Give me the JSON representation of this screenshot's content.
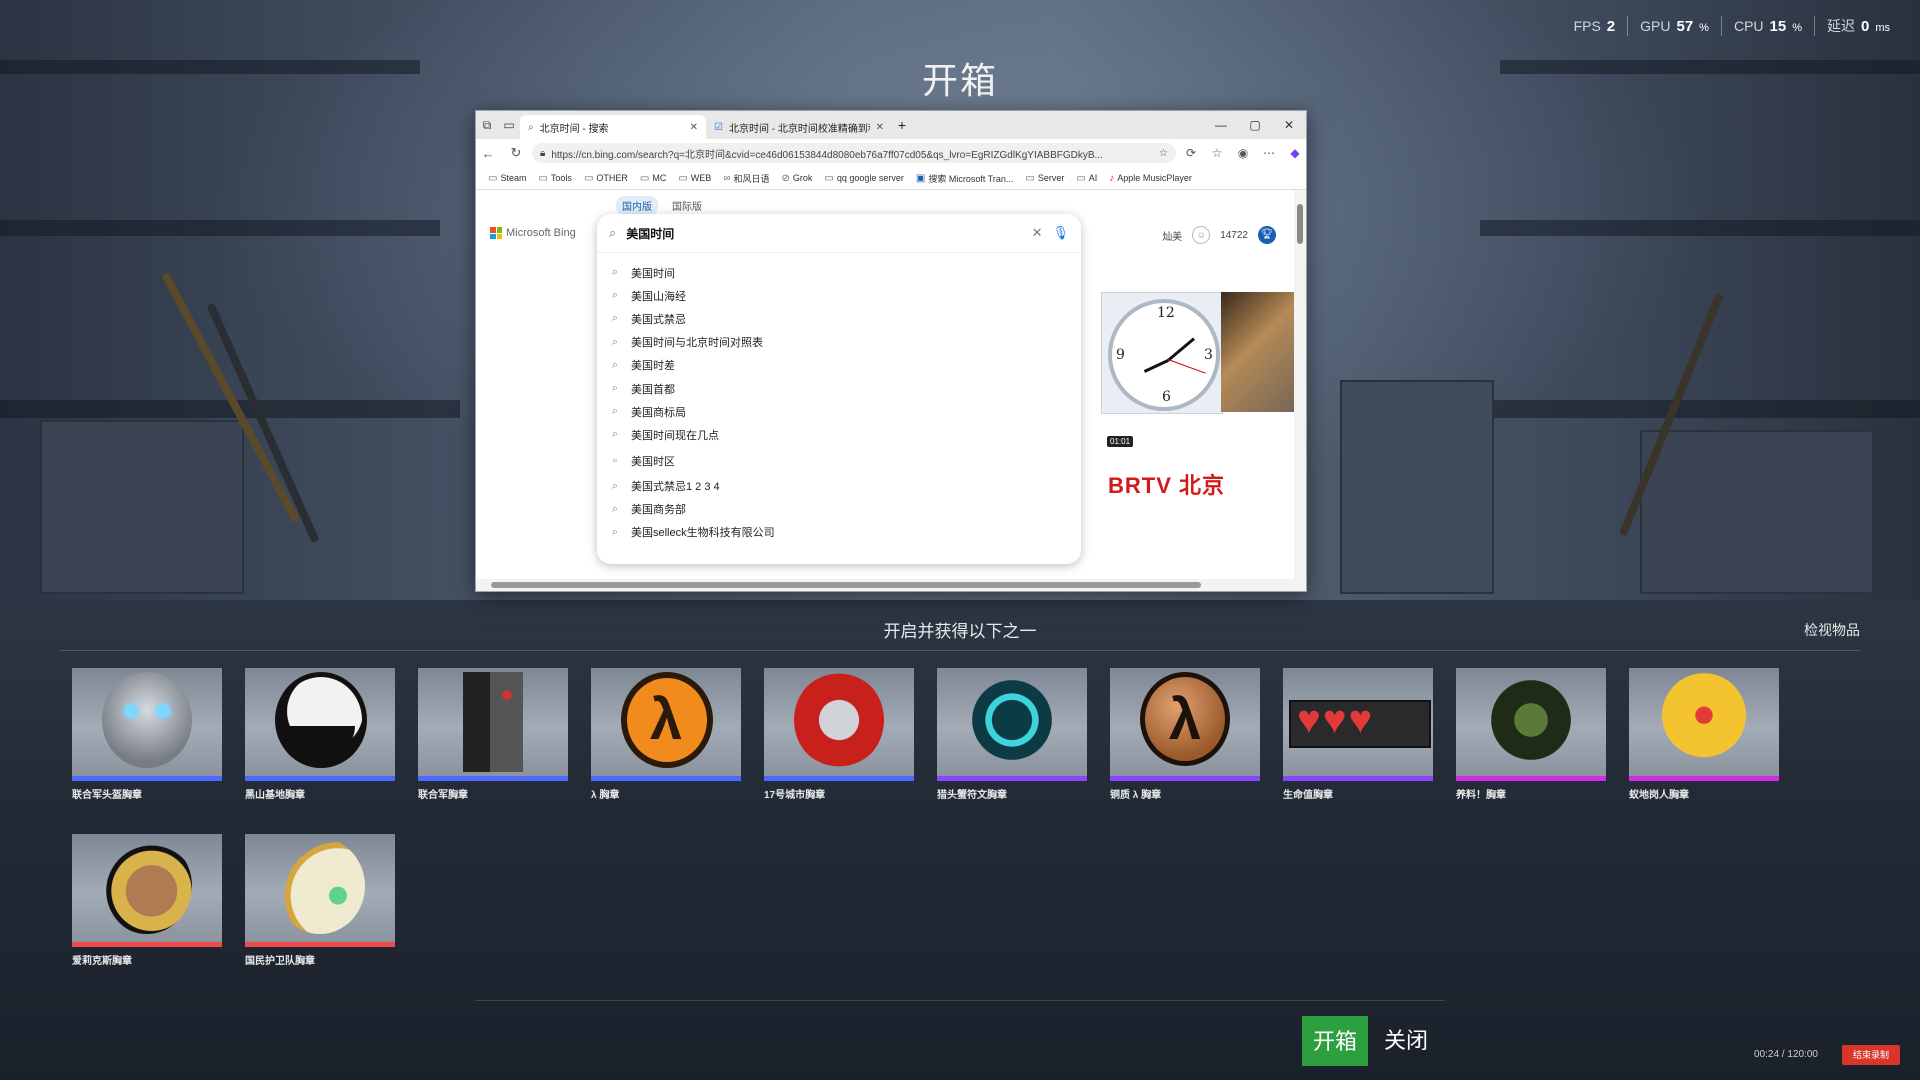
{
  "hud": {
    "fps_label": "FPS",
    "fps_value": "2",
    "gpu_label": "GPU",
    "gpu_value": "57",
    "gpu_unit": "%",
    "cpu_label": "CPU",
    "cpu_value": "15",
    "cpu_unit": "%",
    "latency_label": "延迟",
    "latency_value": "0",
    "latency_unit": "ms"
  },
  "title": "开箱",
  "browser": {
    "tabs": [
      {
        "label": "北京时间 - 搜索"
      },
      {
        "label": "北京时间 - 北京时间校准精确到秒"
      }
    ],
    "url": "https://cn.bing.com/search?q=北京时间&cvid=ce46d06153844d8080eb76a7ff07cd05&qs_lvro=EgRIZGdlKgYIABBFGDkyB...",
    "favorites": [
      "Steam",
      "Tools",
      "OTHER",
      "MC",
      "WEB",
      "和风日语",
      "Grok",
      "qq google server",
      "搜索 Microsoft Tran...",
      "Server",
      "AI",
      "Apple MusicPlayer"
    ],
    "scope_tabs": [
      "国内版",
      "国际版"
    ],
    "logo_text": "Microsoft Bing",
    "search_query": "美国时间",
    "suggestions": [
      "美国时间",
      "美国山海经",
      "美国式禁忌",
      "美国时间与北京时间对照表",
      "美国时差",
      "美国首都",
      "美国商标局",
      "美国时间现在几点",
      "美国时区",
      "美国式禁忌1 2 3 4",
      "美国商务部",
      "美国selleck生物科技有限公司"
    ],
    "user_name": "灿美",
    "points": "14722",
    "video_duration": "01:01",
    "video_brand": "BRTV 北京"
  },
  "panel": {
    "heading": "开启并获得以下之一",
    "inspect_label": "检视物品"
  },
  "items": [
    {
      "name": "联合军头盔胸章",
      "rarity_color": "#4b69ff"
    },
    {
      "name": "黑山基地胸章",
      "rarity_color": "#4b69ff"
    },
    {
      "name": "联合军胸章",
      "rarity_color": "#4b69ff"
    },
    {
      "name": "λ 胸章",
      "rarity_color": "#4b69ff"
    },
    {
      "name": "17号城市胸章",
      "rarity_color": "#4b69ff"
    },
    {
      "name": "猎头蟹符文胸章",
      "rarity_color": "#8847ff"
    },
    {
      "name": "铜质 λ 胸章",
      "rarity_color": "#8847ff"
    },
    {
      "name": "生命值胸章",
      "rarity_color": "#8847ff"
    },
    {
      "name": "养料！胸章",
      "rarity_color": "#d32ce6"
    },
    {
      "name": "蚁地岗人胸章",
      "rarity_color": "#d32ce6"
    },
    {
      "name": "爱莉克斯胸章",
      "rarity_color": "#eb4b4b"
    },
    {
      "name": "国民护卫队胸章",
      "rarity_color": "#eb4b4b"
    }
  ],
  "actions": {
    "open_label": "开箱",
    "close_label": "关闭"
  },
  "recording": {
    "timer": "00:24 / 120:00",
    "stop_label": "结束录制"
  }
}
